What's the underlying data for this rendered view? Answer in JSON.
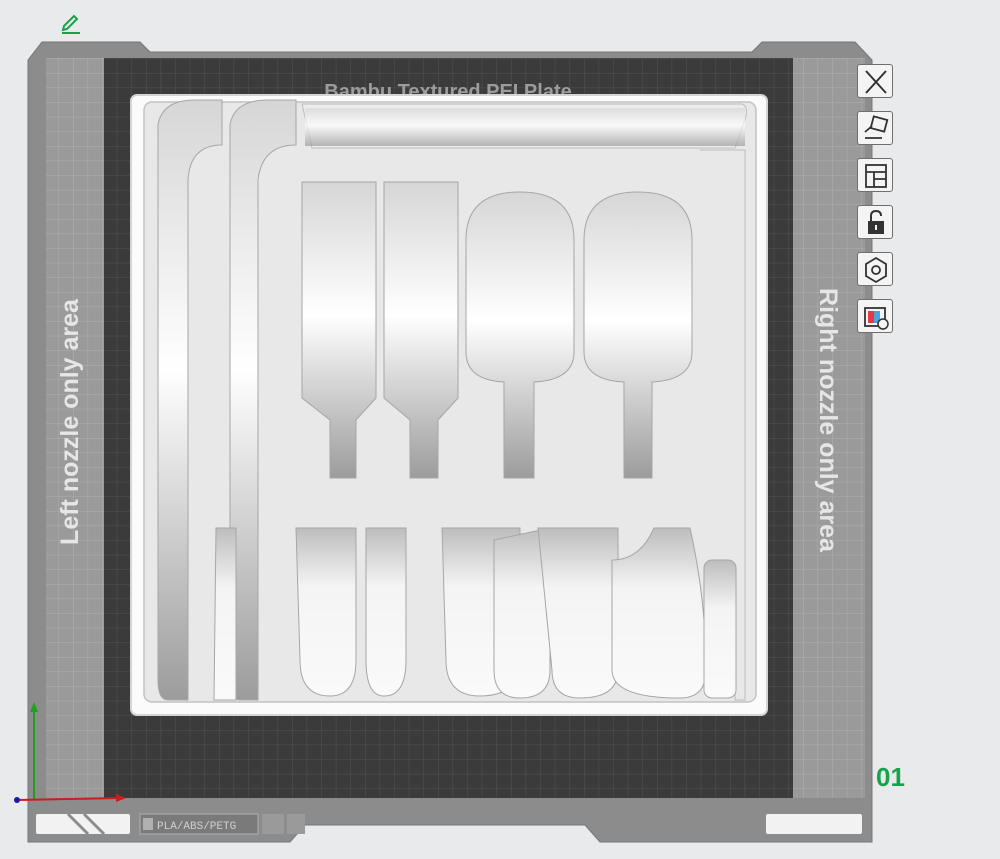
{
  "plate": {
    "name": "Bambu Textured PEI Plate",
    "left_area_label": "Left nozzle only area",
    "right_area_label": "Right nozzle only area",
    "material_label": "PLA/ABS/PETG",
    "number": "01"
  },
  "toolbar": {
    "items": [
      {
        "name": "close-icon"
      },
      {
        "name": "auto-orient-icon"
      },
      {
        "name": "arrange-icon"
      },
      {
        "name": "lock-icon"
      },
      {
        "name": "plate-settings-icon"
      },
      {
        "name": "filament-map-icon"
      }
    ]
  },
  "colors": {
    "background": "#e9eaeb",
    "plate_dark": "#3b3b3b",
    "plate_border": "#8c8c8c",
    "nozzle_area": "#9a9a9a",
    "model": "#f2f2f2",
    "accent_green": "#17a34a"
  }
}
